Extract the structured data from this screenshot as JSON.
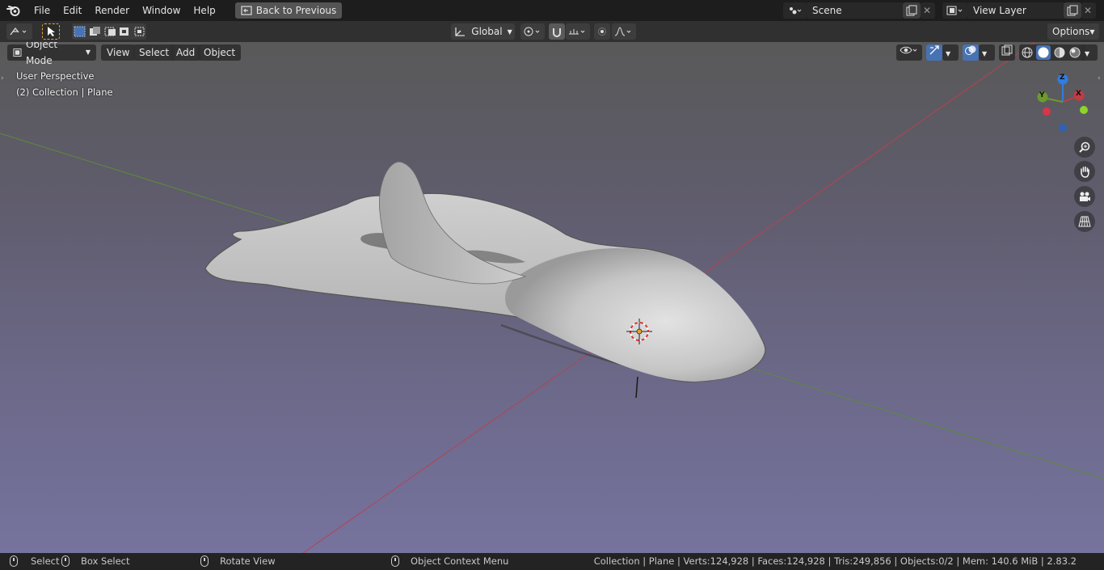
{
  "menu": {
    "items": [
      "File",
      "Edit",
      "Render",
      "Window",
      "Help"
    ],
    "back_button": "Back to Previous"
  },
  "scene": {
    "label": "Scene",
    "view_layer": "View Layer"
  },
  "toolbar": {
    "orientation": "Global",
    "options": "Options"
  },
  "viewport_header": {
    "mode": "Object Mode",
    "view": "View",
    "select": "Select",
    "add": "Add",
    "object": "Object"
  },
  "overlay": {
    "perspective": "User Perspective",
    "collection": "(2) Collection | Plane"
  },
  "gizmo": {
    "z": "Z",
    "y": "Y",
    "x": "X"
  },
  "colors": {
    "x_axis": "#c23b44",
    "y_axis": "#6b9b2b",
    "z_axis": "#2f7de1",
    "accent": "#4772b3"
  },
  "statusbar": {
    "select": "Select",
    "box_select": "Box Select",
    "rotate_view": "Rotate View",
    "context_menu": "Object Context Menu",
    "stats": "Collection | Plane | Verts:124,928 | Faces:124,928 | Tris:249,856 | Objects:0/2 | Mem: 140.6 MiB | 2.83.2"
  }
}
